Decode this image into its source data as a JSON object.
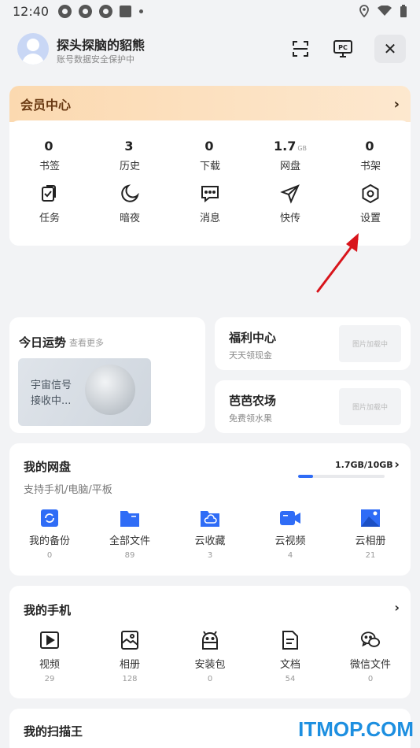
{
  "status_bar": {
    "time": "12:40"
  },
  "header": {
    "username": "探头探脑的貂熊",
    "subtitle": "账号数据安全保护中",
    "pc_label": "PC"
  },
  "vip": {
    "title": "会员中心",
    "stats": [
      {
        "value": "0",
        "unit": "",
        "label": "书签"
      },
      {
        "value": "3",
        "unit": "",
        "label": "历史"
      },
      {
        "value": "0",
        "unit": "",
        "label": "下载"
      },
      {
        "value": "1.7",
        "unit": "GB",
        "label": "网盘"
      },
      {
        "value": "0",
        "unit": "",
        "label": "书架"
      }
    ],
    "tools": [
      {
        "label": "任务",
        "icon": "task-icon"
      },
      {
        "label": "暗夜",
        "icon": "moon-icon"
      },
      {
        "label": "消息",
        "icon": "message-icon"
      },
      {
        "label": "快传",
        "icon": "send-icon"
      },
      {
        "label": "设置",
        "icon": "settings-icon"
      }
    ]
  },
  "fortune": {
    "title": "今日运势",
    "more": "查看更多",
    "image_text_line1": "宇宙信号",
    "image_text_line2": "接收中..."
  },
  "welfare": {
    "title": "福利中心",
    "subtitle": "天天领现金",
    "image_placeholder": "图片加载中"
  },
  "farm": {
    "title": "芭芭农场",
    "subtitle": "免费领水果",
    "image_placeholder": "图片加载中"
  },
  "disk": {
    "title": "我的网盘",
    "subtitle": "支持手机/电脑/平板",
    "usage": "1.7GB/10GB",
    "usage_fraction": 0.17,
    "items": [
      {
        "label": "我的备份",
        "count": "0",
        "icon": "backup-icon"
      },
      {
        "label": "全部文件",
        "count": "89",
        "icon": "folder-icon"
      },
      {
        "label": "云收藏",
        "count": "3",
        "icon": "cloud-folder-icon"
      },
      {
        "label": "云视频",
        "count": "4",
        "icon": "video-camera-icon"
      },
      {
        "label": "云相册",
        "count": "21",
        "icon": "photo-album-icon"
      }
    ]
  },
  "phone": {
    "title": "我的手机",
    "items": [
      {
        "label": "视频",
        "count": "29",
        "icon": "play-icon"
      },
      {
        "label": "相册",
        "count": "128",
        "icon": "image-icon"
      },
      {
        "label": "安装包",
        "count": "0",
        "icon": "android-icon"
      },
      {
        "label": "文档",
        "count": "54",
        "icon": "document-icon"
      },
      {
        "label": "微信文件",
        "count": "0",
        "icon": "wechat-icon"
      }
    ]
  },
  "scan": {
    "title": "我的扫描王"
  },
  "watermark": "ITMOP.COM",
  "colors": {
    "accent": "#2f6cf6",
    "vip_brown": "#6a3a13",
    "annotation_red": "#d8141b"
  }
}
